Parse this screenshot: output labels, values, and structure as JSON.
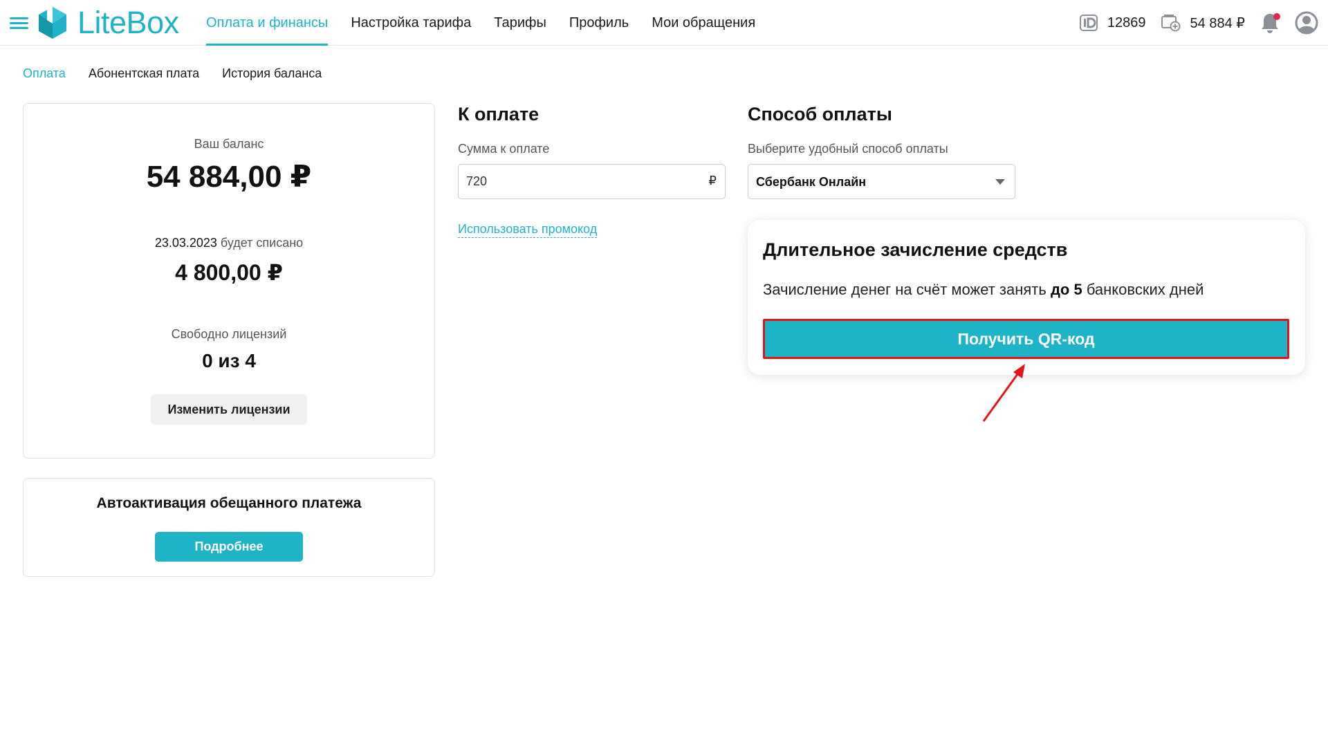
{
  "header": {
    "logo_text": "LiteBox",
    "nav": [
      {
        "label": "Оплата и финансы",
        "active": true
      },
      {
        "label": "Настройка тарифа",
        "active": false
      },
      {
        "label": "Тарифы",
        "active": false
      },
      {
        "label": "Профиль",
        "active": false
      },
      {
        "label": "Мои обращения",
        "active": false
      }
    ],
    "account_id": "12869",
    "balance": "54 884 ₽",
    "accent_color": "#1fb3c7",
    "notification_color": "#e2264d"
  },
  "subtabs": [
    {
      "label": "Оплата",
      "active": true
    },
    {
      "label": "Абонентская плата",
      "active": false
    },
    {
      "label": "История баланса",
      "active": false
    }
  ],
  "balance_card": {
    "balance_label": "Ваш баланс",
    "balance_value": "54 884,00 ₽",
    "charge_date": "23.03.2023",
    "charge_label": " будет списано",
    "charge_value": "4 800,00 ₽",
    "licenses_label": "Свободно лицензий",
    "licenses_value": "0 из 4",
    "change_licenses_button": "Изменить лицензии"
  },
  "auto_card": {
    "title": "Автоактивация обещанного платежа",
    "button": "Подробнее"
  },
  "payment": {
    "title": "К оплате",
    "amount_label": "Сумма к оплате",
    "amount_value": "720",
    "currency": "₽",
    "promo_link": "Использовать промокод"
  },
  "method": {
    "title": "Способ оплаты",
    "subtitle": "Выберите удобный способ оплаты",
    "selected": "Сбербанк Онлайн"
  },
  "info_card": {
    "title": "Длительное зачисление средств",
    "text_before": "Зачисление денег на счёт может занять ",
    "text_bold": "до 5",
    "text_after": " банковских дней",
    "qr_button": "Получить QR-код",
    "highlight_color": "#e3141b"
  }
}
